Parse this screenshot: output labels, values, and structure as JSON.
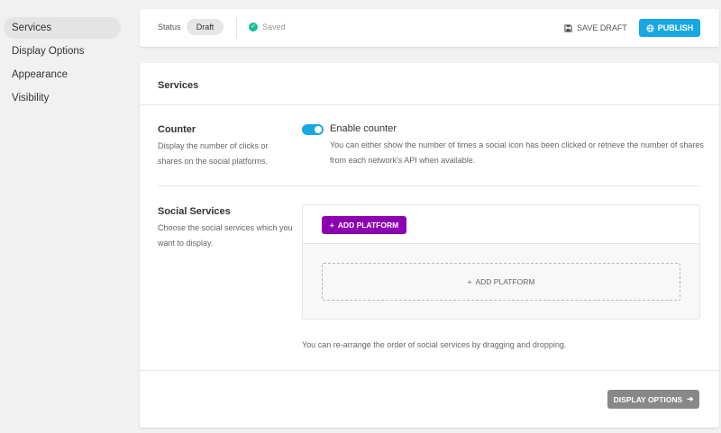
{
  "sidebar": {
    "items": [
      {
        "label": "Services",
        "active": true
      },
      {
        "label": "Display Options"
      },
      {
        "label": "Appearance"
      },
      {
        "label": "Visibility"
      }
    ]
  },
  "topbar": {
    "status_label": "Status",
    "status_value": "Draft",
    "saved_text": "Saved",
    "save_draft_label": "SAVE DRAFT",
    "save_draft_icon": "save-icon",
    "publish_label": "PUBLISH",
    "publish_icon": "globe-icon",
    "accent_color": "#17a8e3"
  },
  "panel": {
    "title": "Services",
    "counter": {
      "title": "Counter",
      "description": "Display the number of clicks or shares on the social platforms.",
      "toggle_label": "Enable counter",
      "toggle_on": true,
      "help": "You can either show the number of times a social icon has been clicked or retrieve the number of shares from each network's API when available."
    },
    "social_services": {
      "title": "Social Services",
      "description": "Choose the social services which you want to display.",
      "add_button": "ADD PLATFORM",
      "add_button_color": "#8d00b2",
      "dropzone_label": "ADD PLATFORM",
      "arrange_note": "You can re-arrange the order of social services by dragging and dropping."
    },
    "footer": {
      "next_button": "DISPLAY OPTIONS"
    }
  }
}
